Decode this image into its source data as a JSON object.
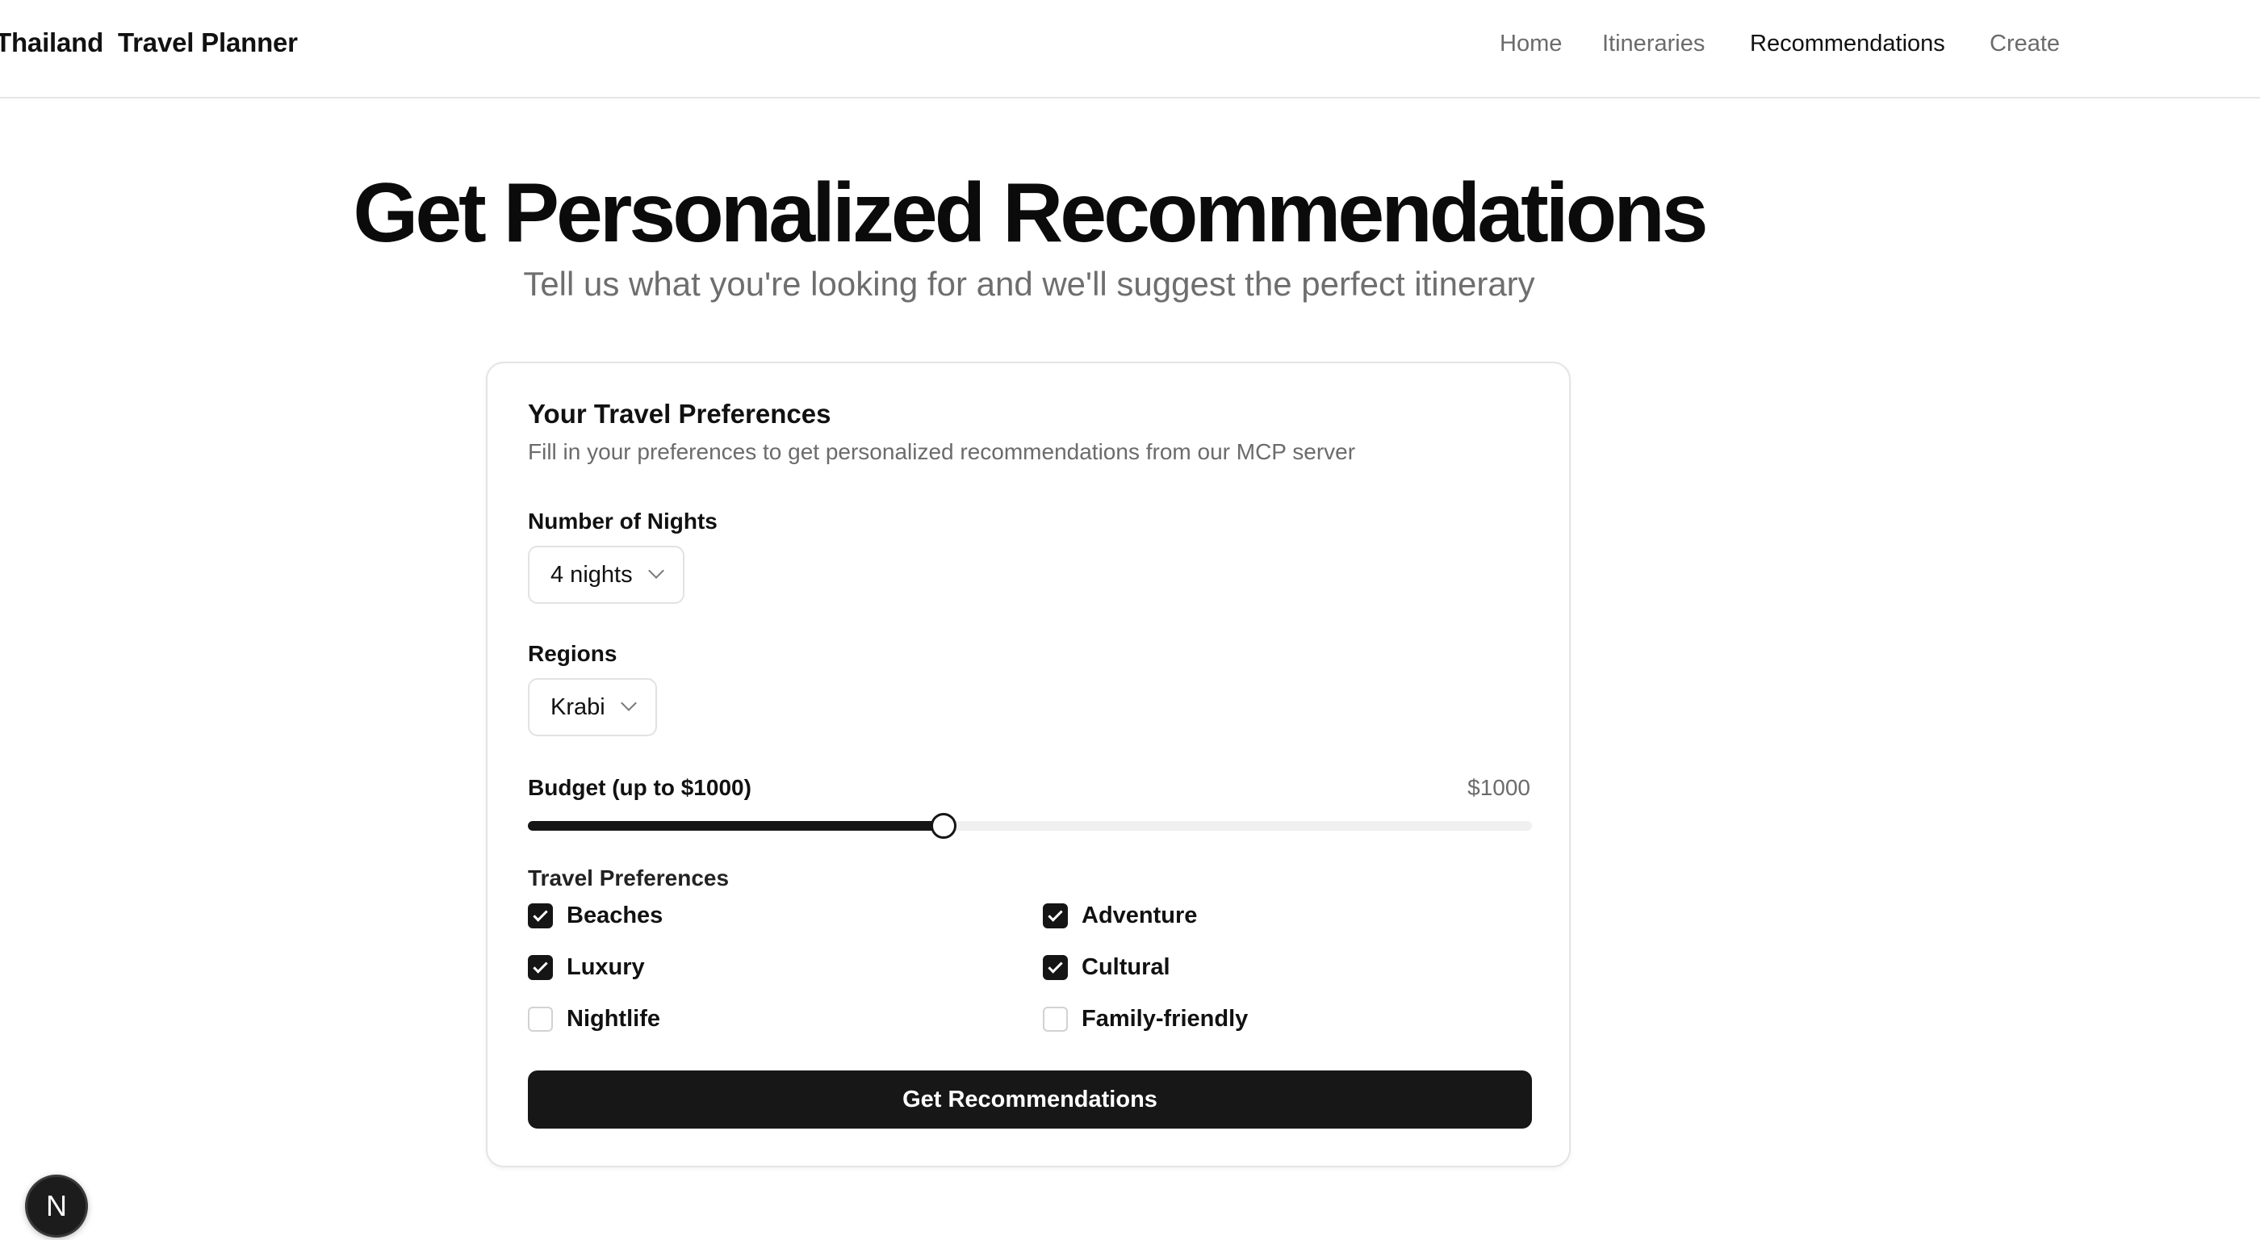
{
  "header": {
    "brand": "Thailand  Travel Planner",
    "nav": [
      {
        "label": "Home",
        "active": false
      },
      {
        "label": "Itineraries",
        "active": false
      },
      {
        "label": "Recommendations",
        "active": true
      },
      {
        "label": "Create",
        "active": false
      }
    ]
  },
  "hero": {
    "title": "Get Personalized Recommendations",
    "subtitle": "Tell us what you're looking for and we'll suggest the perfect itinerary"
  },
  "card": {
    "title": "Your Travel Preferences",
    "description": "Fill in your preferences to get personalized recommendations from our MCP server",
    "nights": {
      "label": "Number of Nights",
      "value": "4 nights"
    },
    "regions": {
      "label": "Regions",
      "value": "Krabi"
    },
    "budget": {
      "label": "Budget (up to $1000)",
      "value_text": "$1000",
      "fraction": 0.414
    },
    "preferences": {
      "label": "Travel Preferences",
      "items": [
        {
          "label": "Beaches",
          "checked": true
        },
        {
          "label": "Adventure",
          "checked": true
        },
        {
          "label": "Luxury",
          "checked": true
        },
        {
          "label": "Cultural",
          "checked": true
        },
        {
          "label": "Nightlife",
          "checked": false
        },
        {
          "label": "Family-friendly",
          "checked": false
        }
      ]
    },
    "submit_label": "Get Recommendations"
  },
  "badge": {
    "letter": "N"
  },
  "colors": {
    "accent": "#151515",
    "muted_text": "#6b6b6b",
    "border": "#e4e4e4"
  }
}
